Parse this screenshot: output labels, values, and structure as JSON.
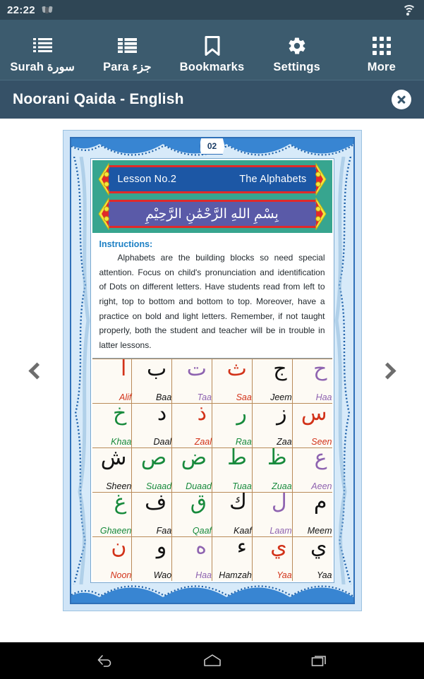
{
  "status_bar": {
    "time": "22:22",
    "icons": [
      "app-notification-icon",
      "wifi-icon"
    ]
  },
  "toolbar": {
    "items": [
      {
        "label": "Surah سورة",
        "icon": "list-icon"
      },
      {
        "label": "Para جزء",
        "icon": "grid-list-icon"
      },
      {
        "label": "Bookmarks",
        "icon": "bookmark-icon"
      },
      {
        "label": "Settings",
        "icon": "gear-icon"
      },
      {
        "label": "More",
        "icon": "apps-grid-icon"
      }
    ]
  },
  "title_bar": {
    "title": "Noorani Qaida - English",
    "close_icon": "close-icon"
  },
  "viewer": {
    "prev_icon": "chevron-left-icon",
    "next_icon": "chevron-right-icon",
    "page_number": "02"
  },
  "lesson": {
    "lesson_no": "Lesson No.2",
    "lesson_title": "The Alphabets",
    "bismillah": "بِسْمِ اللهِ الرَّحْمَٰنِ الرَّحِيْمِ",
    "instructions_heading": "Instructions:",
    "instructions_body": "Alphabets are the building blocks so need special attention. Focus on child's pronunciation and identification of Dots on different letters. Have students read from left to right, top to bottom and bottom to top. Moreover, have a practice on bold and light letters. Remember, if not taught properly, both the student and teacher will be in trouble in latter lessons."
  },
  "alphabet_grid": {
    "rows": [
      [
        {
          "glyph": "ح",
          "name": "Haa",
          "color": "purple"
        },
        {
          "glyph": "ج",
          "name": "Jeem",
          "color": "black"
        },
        {
          "glyph": "ث",
          "name": "Saa",
          "color": "red"
        },
        {
          "glyph": "ت",
          "name": "Taa",
          "color": "purple"
        },
        {
          "glyph": "ب",
          "name": "Baa",
          "color": "black"
        },
        {
          "glyph": "ا",
          "name": "Alif",
          "color": "red"
        }
      ],
      [
        {
          "glyph": "س",
          "name": "Seen",
          "color": "red"
        },
        {
          "glyph": "ز",
          "name": "Zaa",
          "color": "black"
        },
        {
          "glyph": "ر",
          "name": "Raa",
          "color": "green"
        },
        {
          "glyph": "ذ",
          "name": "Zaal",
          "color": "red"
        },
        {
          "glyph": "د",
          "name": "Daal",
          "color": "black"
        },
        {
          "glyph": "خ",
          "name": "Khaa",
          "color": "green"
        }
      ],
      [
        {
          "glyph": "ع",
          "name": "Aeen",
          "color": "purple"
        },
        {
          "glyph": "ظ",
          "name": "Zuaa",
          "color": "green"
        },
        {
          "glyph": "ط",
          "name": "Tuaa",
          "color": "green"
        },
        {
          "glyph": "ض",
          "name": "Duaad",
          "color": "green"
        },
        {
          "glyph": "ص",
          "name": "Suaad",
          "color": "green"
        },
        {
          "glyph": "ش",
          "name": "Sheen",
          "color": "black"
        }
      ],
      [
        {
          "glyph": "م",
          "name": "Meem",
          "color": "black"
        },
        {
          "glyph": "ل",
          "name": "Laam",
          "color": "purple"
        },
        {
          "glyph": "ك",
          "name": "Kaaf",
          "color": "black"
        },
        {
          "glyph": "ق",
          "name": "Qaaf",
          "color": "green"
        },
        {
          "glyph": "ف",
          "name": "Faa",
          "color": "black"
        },
        {
          "glyph": "غ",
          "name": "Ghaeen",
          "color": "green"
        }
      ],
      [
        {
          "glyph": "ي",
          "name": "Yaa",
          "color": "black"
        },
        {
          "glyph": "ي",
          "name": "Yaa",
          "color": "red"
        },
        {
          "glyph": "ء",
          "name": "Hamzah",
          "color": "black"
        },
        {
          "glyph": "ه",
          "name": "Haa",
          "color": "purple"
        },
        {
          "glyph": "و",
          "name": "Wao",
          "color": "black"
        },
        {
          "glyph": "ن",
          "name": "Noon",
          "color": "red"
        }
      ]
    ]
  },
  "system_nav": {
    "back_icon": "back-arrow-icon",
    "home_icon": "home-icon",
    "recents_icon": "recents-icon"
  },
  "colors": {
    "toolbar": "#3c5b6e",
    "title_bar": "#365167",
    "status_bar": "#2f4655",
    "banner_teal": "#37a58f",
    "ribbon_blue": "#1c57a5",
    "ribbon_purple": "#5a5aa8",
    "instructions_heading": "#1b7fc4",
    "page_border": "#2f70b8"
  }
}
